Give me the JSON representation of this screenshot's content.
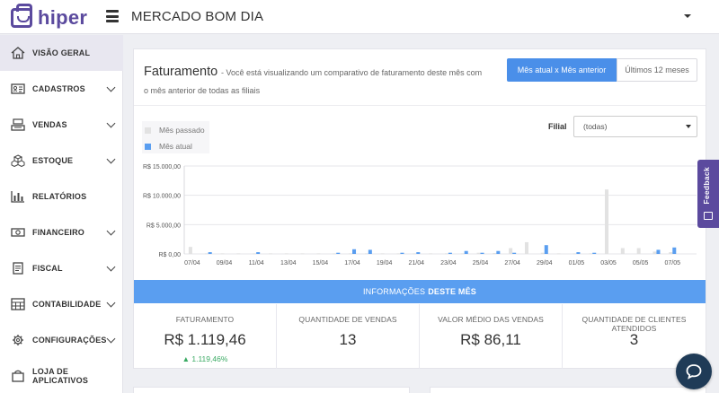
{
  "app": {
    "logo_text": "hiper",
    "store_name": "MERCADO BOM DIA"
  },
  "sidebar": {
    "items": [
      {
        "label": "VISÃO GERAL",
        "icon": "home-icon",
        "expandable": false,
        "active": true
      },
      {
        "label": "CADASTROS",
        "icon": "id-card-icon",
        "expandable": true
      },
      {
        "label": "VENDAS",
        "icon": "cash-register-icon",
        "expandable": true
      },
      {
        "label": "ESTOQUE",
        "icon": "boxes-icon",
        "expandable": true
      },
      {
        "label": "RELATÓRIOS",
        "icon": "bar-chart-icon",
        "expandable": false
      },
      {
        "label": "FINANCEIRO",
        "icon": "money-icon",
        "expandable": true
      },
      {
        "label": "FISCAL",
        "icon": "document-icon",
        "expandable": true
      },
      {
        "label": "CONTABILIDADE",
        "icon": "calculator-icon",
        "expandable": true
      },
      {
        "label": "CONFIGURAÇÕES",
        "icon": "gear-icon",
        "expandable": true
      },
      {
        "label": "LOJA DE APLICATIVOS",
        "icon": "shopping-bag-icon",
        "expandable": false
      }
    ]
  },
  "billing": {
    "title": "Faturamento",
    "subtitle_line1": "- Você está visualizando um comparativo de faturamento deste mês com",
    "subtitle_line2": "o mês anterior de todas as filiais",
    "btn_compare": "Mês atual x Mês anterior",
    "btn_last12": "Últimos 12 meses",
    "legend": {
      "previous": "Mês passado",
      "current": "Mês atual"
    },
    "filial_label": "Filial",
    "filial_value": "(todas)"
  },
  "chart_data": {
    "type": "bar",
    "y_ticks": [
      "R$ 15.000,00",
      "R$ 10.000,00",
      "R$ 5.000,00",
      "R$ 0,00"
    ],
    "ylim": [
      0,
      15000
    ],
    "x_tick_labels": [
      "07/04",
      "09/04",
      "11/04",
      "13/04",
      "15/04",
      "17/04",
      "19/04",
      "21/04",
      "23/04",
      "25/04",
      "27/04",
      "29/04",
      "01/05",
      "03/05",
      "05/05",
      "07/05"
    ],
    "categories": [
      "07/04",
      "08/04",
      "09/04",
      "10/04",
      "11/04",
      "12/04",
      "13/04",
      "14/04",
      "15/04",
      "16/04",
      "17/04",
      "18/04",
      "19/04",
      "20/04",
      "21/04",
      "22/04",
      "23/04",
      "24/04",
      "25/04",
      "26/04",
      "27/04",
      "28/04",
      "29/04",
      "30/04",
      "01/05",
      "02/05",
      "03/05",
      "04/05",
      "05/05",
      "06/05",
      "07/05",
      "08/05"
    ],
    "series": [
      {
        "name": "Mês passado",
        "color": "#e2e2e2",
        "values": [
          1200,
          100,
          100,
          100,
          100,
          100,
          100,
          100,
          100,
          100,
          100,
          100,
          100,
          100,
          100,
          100,
          100,
          100,
          200,
          150,
          1000,
          2000,
          200,
          100,
          100,
          100,
          11000,
          1000,
          1000,
          400,
          300,
          0
        ]
      },
      {
        "name": "Mês atual",
        "color": "#5a9ef0",
        "values": [
          0,
          300,
          0,
          0,
          300,
          0,
          0,
          0,
          0,
          200,
          800,
          700,
          0,
          200,
          300,
          0,
          200,
          500,
          200,
          500,
          200,
          0,
          1500,
          0,
          300,
          200,
          0,
          0,
          0,
          700,
          1100,
          0
        ]
      }
    ],
    "grid": true
  },
  "info": {
    "prefix": "INFORMAÇÕES",
    "bold": "DESTE MÊS"
  },
  "stats": [
    {
      "label": "FATURAMENTO",
      "value": "R$ 1.119,46",
      "delta": "▲ 1.119,46%"
    },
    {
      "label": "QUANTIDADE DE VENDAS",
      "value": "13"
    },
    {
      "label": "VALOR MÉDIO DAS VENDAS",
      "value": "R$ 86,11"
    },
    {
      "label": "QUANTIDADE DE CLIENTES ATENDIDOS",
      "value": "3"
    }
  ],
  "feedback": {
    "label": "Feedback"
  },
  "colors": {
    "brand": "#5b4a9e",
    "primary": "#4a8fe9",
    "info_bar": "#5a9ef0",
    "positive": "#3aaa63",
    "chat": "#1f3b57"
  }
}
